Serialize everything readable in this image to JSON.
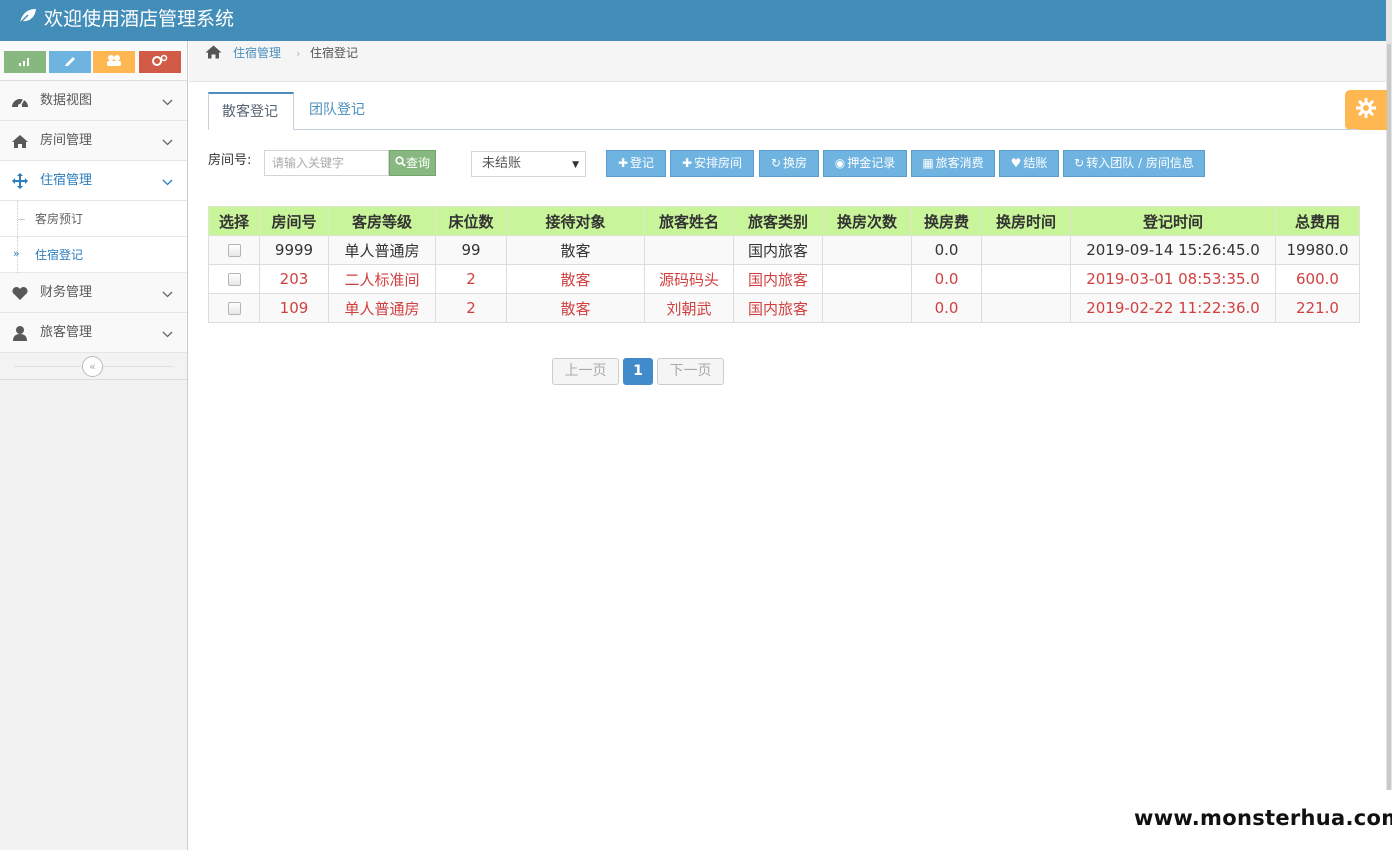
{
  "app": {
    "title": "欢迎使用酒店管理系统"
  },
  "sidebar": {
    "shortcuts": [
      {
        "name": "signal",
        "color": "#87b87f"
      },
      {
        "name": "pencil",
        "color": "#6fb3e0"
      },
      {
        "name": "users",
        "color": "#ffb752"
      },
      {
        "name": "cogs",
        "color": "#d15b47"
      }
    ],
    "items": [
      {
        "label": "数据视图",
        "icon": "dashboard-icon"
      },
      {
        "label": "房间管理",
        "icon": "home-icon"
      },
      {
        "label": "住宿管理",
        "icon": "move-icon",
        "open": true,
        "children": [
          {
            "label": "客房预订"
          },
          {
            "label": "住宿登记",
            "active": true
          }
        ]
      },
      {
        "label": "财务管理",
        "icon": "heart-icon"
      },
      {
        "label": "旅客管理",
        "icon": "user-icon"
      }
    ],
    "collapse_glyph": "«"
  },
  "breadcrumb": {
    "parent": "住宿管理",
    "current": "住宿登记",
    "separator": "›"
  },
  "tabs": [
    {
      "label": "散客登记",
      "active": true
    },
    {
      "label": "团队登记",
      "active": false
    }
  ],
  "toolbar": {
    "room_label": "房间号:",
    "search_placeholder": "请输入关键字",
    "query_label": "查询",
    "status_select": "未结账",
    "buttons": [
      {
        "label": "登记",
        "glyph": "✚"
      },
      {
        "label": "安排房间",
        "glyph": "✚"
      },
      {
        "label": "换房",
        "glyph": "↻"
      },
      {
        "label": "押金记录",
        "glyph": "◉"
      },
      {
        "label": "旅客消费",
        "glyph": "▦"
      },
      {
        "label": "结账",
        "glyph": "♥"
      },
      {
        "label": "转入团队 / 房间信息",
        "glyph": "↻"
      }
    ]
  },
  "table": {
    "headers": [
      "选择",
      "房间号",
      "客房等级",
      "床位数",
      "接待对象",
      "旅客姓名",
      "旅客类别",
      "换房次数",
      "换房费",
      "换房时间",
      "登记时间",
      "总费用"
    ],
    "rows": [
      {
        "red": false,
        "cells": [
          "",
          "9999",
          "单人普通房",
          "99",
          "散客",
          "",
          "国内旅客",
          "",
          "0.0",
          "",
          "2019-09-14 15:26:45.0",
          "19980.0"
        ]
      },
      {
        "red": true,
        "cells": [
          "",
          "203",
          "二人标准间",
          "2",
          "散客",
          "源码码头",
          "国内旅客",
          "",
          "0.0",
          "",
          "2019-03-01 08:53:35.0",
          "600.0"
        ]
      },
      {
        "red": true,
        "cells": [
          "",
          "109",
          "单人普通房",
          "2",
          "散客",
          "刘朝武",
          "国内旅客",
          "",
          "0.0",
          "",
          "2019-02-22 11:22:36.0",
          "221.0"
        ]
      }
    ]
  },
  "pagination": {
    "prev": "上一页",
    "current": "1",
    "next": "下一页"
  },
  "watermark": "www.monsterhua.com",
  "colors": {
    "header": "#438eb9",
    "table_header": "#c9f59a",
    "action_button": "#6fb3e0",
    "query_button": "#87b87f",
    "highlight_text": "#d13f3f",
    "settings": "#ffb752"
  }
}
